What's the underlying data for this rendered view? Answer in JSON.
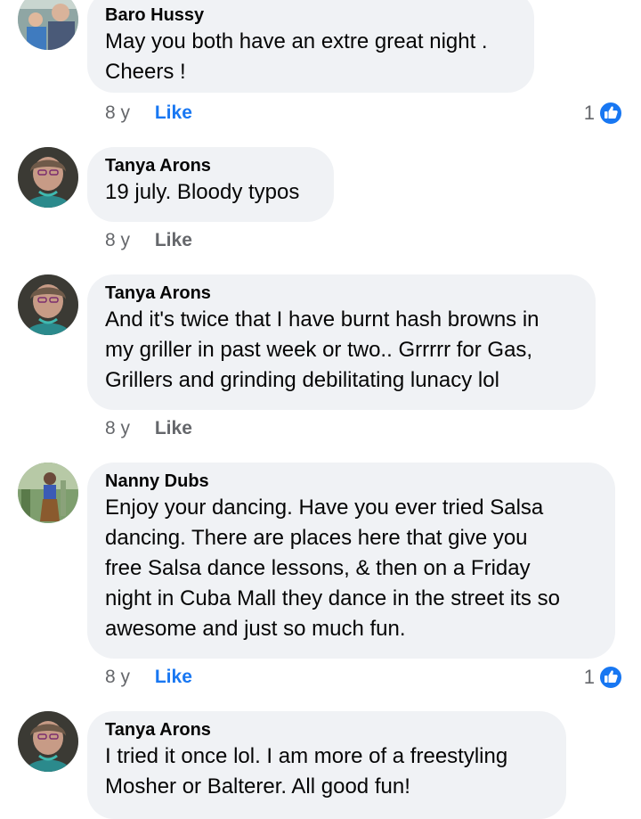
{
  "comments": [
    {
      "author": "Baro Hussy",
      "text": "May you both have an extre great night .\nCheers !",
      "time": "8 y",
      "like_label": "Like",
      "like_active": true,
      "reaction_count": "1",
      "avatar_icon": "person-photo-icon"
    },
    {
      "author": "Tanya Arons",
      "text": "19 july. Bloody typos",
      "time": "8 y",
      "like_label": "Like",
      "like_active": false,
      "avatar_icon": "person-photo-icon"
    },
    {
      "author": "Tanya Arons",
      "text": "And it's twice that I have burnt hash browns in\nmy griller in past week or two..  Grrrrr for Gas,\nGrillers and grinding debilitating lunacy lol",
      "time": "8 y",
      "like_label": "Like",
      "like_active": false,
      "avatar_icon": "person-photo-icon"
    },
    {
      "author": "Nanny Dubs",
      "text": "Enjoy your dancing. Have you ever tried Salsa\ndancing. There are places here that give you\nfree Salsa dance lessons, & then on a Friday\nnight in Cuba Mall they dance in the street its so\nawesome and just so much fun.",
      "time": "8 y",
      "like_label": "Like",
      "like_active": true,
      "reaction_count": "1",
      "avatar_icon": "person-photo-icon"
    },
    {
      "author": "Tanya Arons",
      "text": "I tried it once lol.  I am more of a freestyling\nMosher or Balterer.  All good fun!",
      "avatar_icon": "person-photo-icon"
    }
  ],
  "colors": {
    "bubble": "#f0f2f5",
    "like_active": "#1877f2",
    "meta_text": "#65676b"
  }
}
